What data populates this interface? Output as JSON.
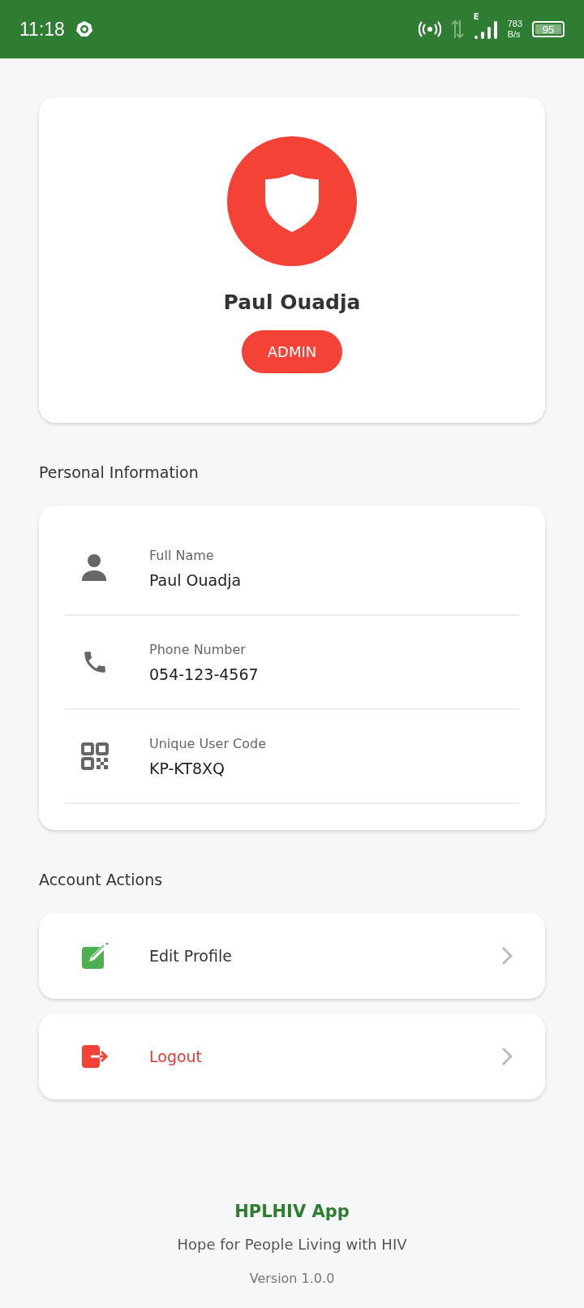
{
  "status_bar": {
    "time": "11:18",
    "network_type": "E",
    "speed_value": "783",
    "speed_unit": "B/s",
    "battery": "95"
  },
  "profile": {
    "name": "Paul Ouadja",
    "role": "ADMIN"
  },
  "personal_information": {
    "heading": "Personal Information",
    "fields": [
      {
        "kind": "person",
        "label": "Full Name",
        "value": "Paul Ouadja"
      },
      {
        "kind": "phone",
        "label": "Phone Number",
        "value": "054-123-4567"
      },
      {
        "kind": "code",
        "label": "Unique User Code",
        "value": "KP-KT8XQ"
      }
    ]
  },
  "account_actions": {
    "heading": "Account Actions",
    "items": [
      {
        "kind": "edit",
        "label": "Edit Profile"
      },
      {
        "kind": "logout",
        "label": "Logout"
      }
    ]
  },
  "footer": {
    "app_name": "HPLHIV App",
    "tagline": "Hope for People Living with HIV",
    "version": "Version 1.0.0"
  }
}
